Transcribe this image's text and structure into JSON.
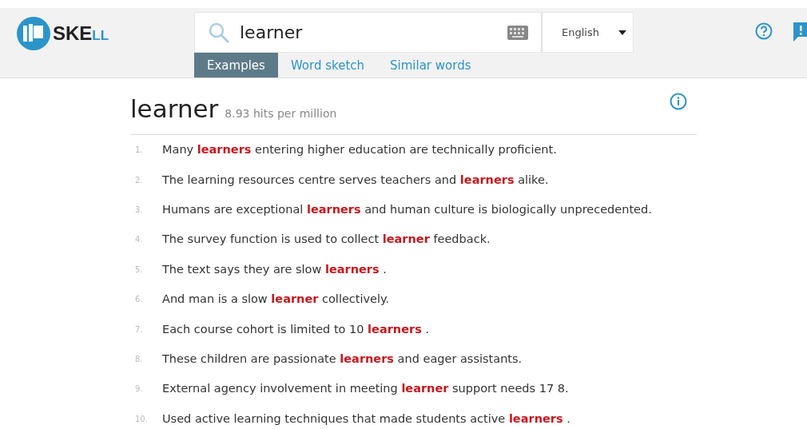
{
  "logo": {
    "main": "SKE",
    "tail": "LL"
  },
  "search": {
    "value": "learner",
    "language": "English"
  },
  "tabs": [
    {
      "label": "Examples",
      "selected": true
    },
    {
      "label": "Word sketch",
      "selected": false
    },
    {
      "label": "Similar words",
      "selected": false
    }
  ],
  "headword": {
    "word": "learner",
    "frequency": "8.93 hits per million"
  },
  "examples": [
    {
      "number": "1.",
      "text": "Many **learners** entering higher education are technically proficient."
    },
    {
      "number": "2.",
      "text": "The learning resources centre serves teachers and **learners** alike."
    },
    {
      "number": "3.",
      "text": "Humans are exceptional **learners** and human culture is biologically unprecedented."
    },
    {
      "number": "4.",
      "text": "The survey function is used to collect **learner** feedback."
    },
    {
      "number": "5.",
      "text": "The text says they are slow **learners** ."
    },
    {
      "number": "6.",
      "text": "And man is a slow **learner** collectively."
    },
    {
      "number": "7.",
      "text": "Each course cohort is limited to 10 **learners** ."
    },
    {
      "number": "8.",
      "text": "These children are passionate **learners** and eager assistants."
    },
    {
      "number": "9.",
      "text": "External agency involvement in meeting **learner** support needs 17 8."
    },
    {
      "number": "10.",
      "text": "Used active learning techniques that made students active **learners** ."
    }
  ]
}
